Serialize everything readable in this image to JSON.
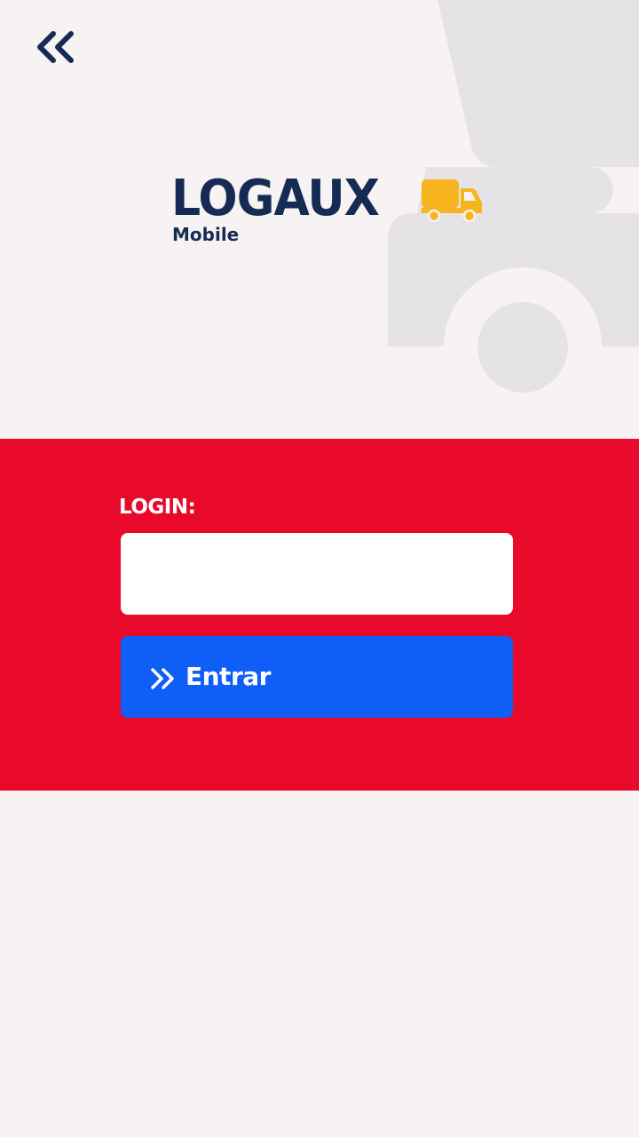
{
  "header": {
    "back_icon": "double-chevron-left-icon"
  },
  "logo": {
    "wordmark": "LOGAUX",
    "subtitle": "Mobile",
    "icon": "delivery-truck-icon"
  },
  "login": {
    "label": "LOGIN:",
    "input_value": "",
    "input_placeholder": "",
    "submit_label": "Entrar",
    "submit_icon": "double-chevron-right-icon"
  },
  "colors": {
    "background": "#f8f3f3",
    "brand_navy": "#152b54",
    "brand_red": "#e8092b",
    "button_blue": "#0f5ef7",
    "truck_yellow": "#f8b41e",
    "watermark_gray": "#e6e3e6"
  }
}
